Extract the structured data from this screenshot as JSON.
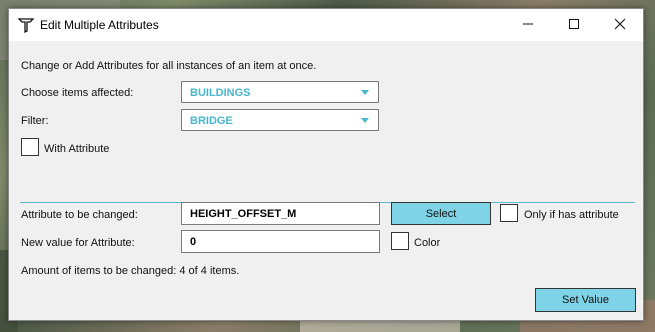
{
  "window": {
    "title": "Edit Multiple Attributes"
  },
  "intro_text": "Change or Add Attributes for all instances of an item at once.",
  "items_affected": {
    "label": "Choose items affected:",
    "value": "BUILDINGS"
  },
  "filter": {
    "label": "Filter:",
    "value": "BRIDGE"
  },
  "with_attribute": {
    "label": "With Attribute",
    "checked": false
  },
  "attribute_to_change": {
    "label": "Attribute to be changed:",
    "value": "HEIGHT_OFFSET_M",
    "select_label": "Select"
  },
  "only_if_has_attribute": {
    "label": "Only if has attribute",
    "checked": false
  },
  "new_value": {
    "label": "New value for Attribute:",
    "value": "0"
  },
  "color_option": {
    "label": "Color",
    "checked": false
  },
  "amount_text": "Amount of items to be changed: 4 of 4 items.",
  "set_value_label": "Set Value",
  "colors": {
    "accent": "#48b6cc",
    "button": "#7fd3e6",
    "divider": "#5db9c8"
  },
  "icons": {
    "app": "attribute-tool-icon",
    "minimize": "minimize-icon",
    "maximize": "maximize-icon",
    "close": "close-icon"
  }
}
